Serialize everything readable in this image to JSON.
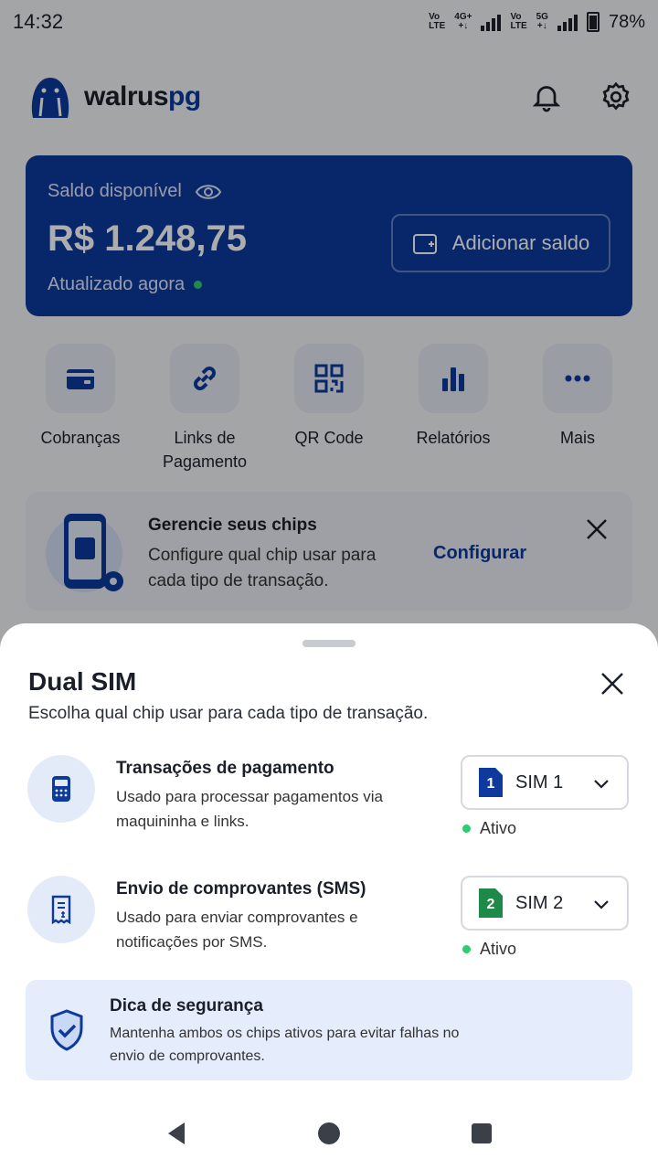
{
  "status_bar": {
    "time": "14:32",
    "sim1_tech": "4G+",
    "sim2_tech": "5G",
    "volte": "Vo\nLTE",
    "battery": "78%"
  },
  "header": {
    "logo_word": "walrus",
    "logo_suffix": "pg"
  },
  "balance": {
    "label": "Saldo disponível",
    "value": "R$ 1.248,75",
    "updated": "Atualizado agora",
    "add_button": "Adicionar saldo"
  },
  "quick_actions": [
    {
      "label": "Cobranças",
      "icon": "wallet-icon"
    },
    {
      "label": "Links de Pagamento",
      "icon": "link-icon"
    },
    {
      "label": "QR Code",
      "icon": "qr-code-icon"
    },
    {
      "label": "Relatórios",
      "icon": "bar-chart-icon"
    },
    {
      "label": "Mais",
      "icon": "more-icon"
    }
  ],
  "chip_banner": {
    "title": "Gerencie seus chips",
    "description": "Configure qual chip usar para cada tipo de transação.",
    "action": "Configurar"
  },
  "sheet": {
    "title": "Dual SIM",
    "subtitle": "Escolha qual chip usar para cada tipo de transação.",
    "rows": [
      {
        "title": "Transações de pagamento",
        "description": "Usado para processar pagamentos via maquininha e links.",
        "sim_number": "1",
        "sim_label": "SIM 1",
        "sim_color": "#0d3a9c",
        "status": "Ativo"
      },
      {
        "title": "Envio de comprovantes (SMS)",
        "description": "Usado para enviar comprovantes e notificações por SMS.",
        "sim_number": "2",
        "sim_label": "SIM 2",
        "sim_color": "#1e8a4a",
        "status": "Ativo"
      }
    ],
    "tip": {
      "title": "Dica de segurança",
      "description": "Mantenha ambos os chips ativos para evitar falhas no envio de comprovantes."
    }
  },
  "colors": {
    "brand": "#0d3a9c",
    "active": "#2ecc71",
    "sim2": "#1e8a4a"
  }
}
